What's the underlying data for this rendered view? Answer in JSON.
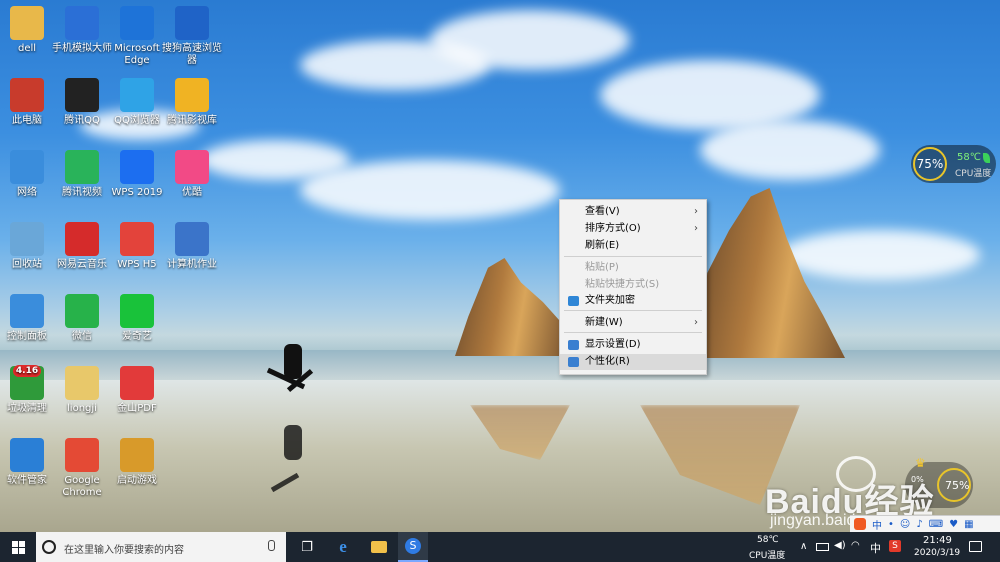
{
  "desktop_icons": [
    {
      "label": "dell",
      "icon": "folder-user-icon",
      "color": "#e8b84a"
    },
    {
      "label": "手机模拟大师",
      "icon": "phone-mouse-icon",
      "color": "#2b6fd6"
    },
    {
      "label": "Microsoft Edge",
      "icon": "edge-icon",
      "color": "#1e73d8"
    },
    {
      "label": "搜狗高速浏览器",
      "icon": "sogou-browser-icon",
      "color": "#1f63c7"
    },
    {
      "label": "此电脑",
      "icon": "computer-icon",
      "color": "#c83b2c"
    },
    {
      "label": "腾讯QQ",
      "icon": "qq-penguin-icon",
      "color": "#222222"
    },
    {
      "label": "QQ浏览器",
      "icon": "qq-browser-icon",
      "color": "#2fa3e6"
    },
    {
      "label": "腾讯影视库",
      "icon": "video-library-icon",
      "color": "#f0b323"
    },
    {
      "label": "网络",
      "icon": "network-icon",
      "color": "#3a8ddc"
    },
    {
      "label": "腾讯视频",
      "icon": "tencent-video-icon",
      "color": "#29b35a"
    },
    {
      "label": "WPS 2019",
      "icon": "wps-icon",
      "color": "#1c6ef0"
    },
    {
      "label": "优酷",
      "icon": "youku-icon",
      "color": "#f24a86"
    },
    {
      "label": "回收站",
      "icon": "recycle-bin-icon",
      "color": "#6aa7d8"
    },
    {
      "label": "网易云音乐",
      "icon": "netease-music-icon",
      "color": "#d52b2b"
    },
    {
      "label": "WPS H5",
      "icon": "wps-h5-icon",
      "color": "#e3433b"
    },
    {
      "label": "计算机作业",
      "icon": "word-document-icon",
      "color": "#3b74c9"
    },
    {
      "label": "控制面板",
      "icon": "control-panel-icon",
      "color": "#3a8ddc"
    },
    {
      "label": "微信",
      "icon": "wechat-icon",
      "color": "#27b24a"
    },
    {
      "label": "爱奇艺",
      "icon": "iqiyi-icon",
      "color": "#19c23a"
    },
    {
      "label": "垃圾清理",
      "icon": "trash-clean-icon",
      "color": "#2f9a3a",
      "badge": "4.16"
    },
    {
      "label": "liongji",
      "icon": "folder-icon",
      "color": "#e8c86a"
    },
    {
      "label": "金山PDF",
      "icon": "pdf-icon",
      "color": "#e23a3a"
    },
    {
      "label": "软件管家",
      "icon": "software-manager-icon",
      "color": "#2a7fd6"
    },
    {
      "label": "Google Chrome",
      "icon": "chrome-icon",
      "color": "#e44a35"
    },
    {
      "label": "启动游戏",
      "icon": "game-launcher-icon",
      "color": "#d89a2a"
    }
  ],
  "context_menu": {
    "items": [
      {
        "label": "查看(V)",
        "submenu": true,
        "disabled": false,
        "icon": ""
      },
      {
        "label": "排序方式(O)",
        "submenu": true,
        "disabled": false,
        "icon": ""
      },
      {
        "label": "刷新(E)",
        "submenu": false,
        "disabled": false,
        "icon": ""
      },
      {
        "label": "粘贴(P)",
        "submenu": false,
        "disabled": true,
        "icon": ""
      },
      {
        "label": "粘贴快捷方式(S)",
        "submenu": false,
        "disabled": true,
        "icon": ""
      },
      {
        "label": "文件夹加密",
        "submenu": false,
        "disabled": false,
        "icon": "folder-lock-icon"
      },
      {
        "label": "新建(W)",
        "submenu": true,
        "disabled": false,
        "icon": ""
      },
      {
        "label": "显示设置(D)",
        "submenu": false,
        "disabled": false,
        "icon": "display-icon"
      },
      {
        "label": "个性化(R)",
        "submenu": false,
        "disabled": false,
        "icon": "personalize-icon",
        "highlighted": true
      }
    ]
  },
  "cpu_widget": {
    "percent": "75%",
    "temp": "58℃",
    "label": "CPU温度"
  },
  "bottom_widget": {
    "percent": "75%",
    "load": "0%"
  },
  "taskbar": {
    "search_placeholder": "在这里输入你要搜索的内容",
    "cpu_temp": "58℃",
    "cpu_label": "CPU温度",
    "ime": "中",
    "time": "21:49",
    "date": "2020/3/19"
  },
  "watermark": {
    "brand": "Baidu经验",
    "url": "jingyan.baidu.com"
  }
}
